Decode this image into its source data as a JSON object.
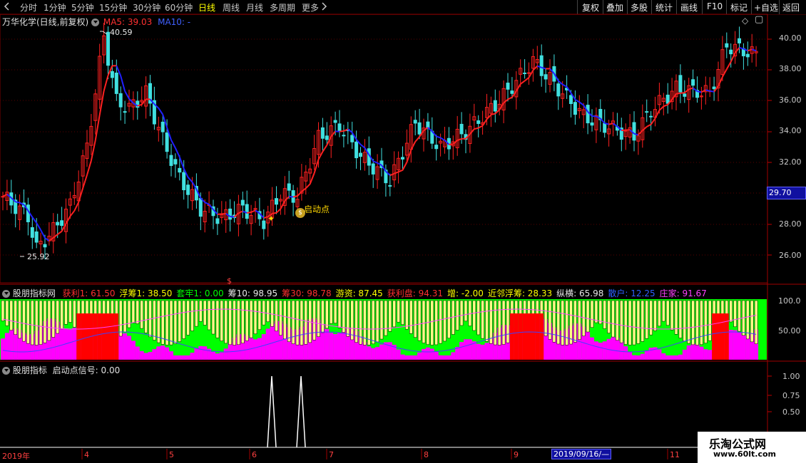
{
  "topbar": {
    "back_icon": "chevron-left-icon",
    "tabs": [
      "分时",
      "1分钟",
      "5分钟",
      "15分钟",
      "30分钟",
      "60分钟",
      "日线",
      "周线",
      "月线",
      "多周期",
      "更多"
    ],
    "active_tab": "日线",
    "more_icon": "chevron-right-icon",
    "right_buttons": [
      "复权",
      "叠加",
      "多股",
      "统计",
      "画线",
      "F10",
      "标记",
      "+自选",
      "返回"
    ]
  },
  "main_panel": {
    "title": "万华化学(日线,前复权)",
    "ma5_label": "MA5: 39.03",
    "ma10_label": "MA10: -",
    "high_label": "40.59",
    "low_label": "25.92",
    "signal_label": "启动点",
    "current_price_tag": "29.70",
    "y_ticks": [
      "40.00",
      "38.00",
      "36.00",
      "34.00",
      "32.00",
      "30.00",
      "28.00",
      "26.00"
    ],
    "colors": {
      "up": "#ff2020",
      "down": "#40e0e0",
      "ma5": "#ff2020",
      "ma10": "#3030ff",
      "label_ma5": "#ff3030",
      "label_ma10": "#4060ff"
    }
  },
  "indicator1": {
    "title": "股朋指标网",
    "fields": [
      {
        "text": "获利1: 61.50",
        "color": "#ff3030"
      },
      {
        "text": "浮筹1: 38.50",
        "color": "#ffff00"
      },
      {
        "text": "套牢1: 0.00",
        "color": "#00ff00"
      },
      {
        "text": "筹10: 98.95",
        "color": "#e8e8e8"
      },
      {
        "text": "筹30: 98.78",
        "color": "#ff3030"
      },
      {
        "text": "游资: 87.45",
        "color": "#ffff00"
      },
      {
        "text": "获利盘: 94.31",
        "color": "#ff3030"
      },
      {
        "text": "增: -2.00",
        "color": "#ffff00"
      },
      {
        "text": "近邻浮筹: 28.33",
        "color": "#ffff00"
      },
      {
        "text": "纵横: 65.98",
        "color": "#e8e8e8"
      },
      {
        "text": "散户: 12.25",
        "color": "#3060ff"
      },
      {
        "text": "庄家: 91.67",
        "color": "#ff40ff"
      }
    ],
    "y_ticks": [
      "100.0",
      "50.00"
    ]
  },
  "indicator2": {
    "title": "股朋指标",
    "signal_text": "启动点信号: 0.00",
    "y_ticks": [
      "1.00",
      "0.75",
      "0.50"
    ]
  },
  "timeline": {
    "labels": [
      "2019年",
      "4",
      "5",
      "6",
      "7",
      "8",
      "9",
      "2019/09/16/—",
      "11"
    ]
  },
  "watermark": {
    "title": "乐淘公式网",
    "url": "www.60lt.com"
  }
}
